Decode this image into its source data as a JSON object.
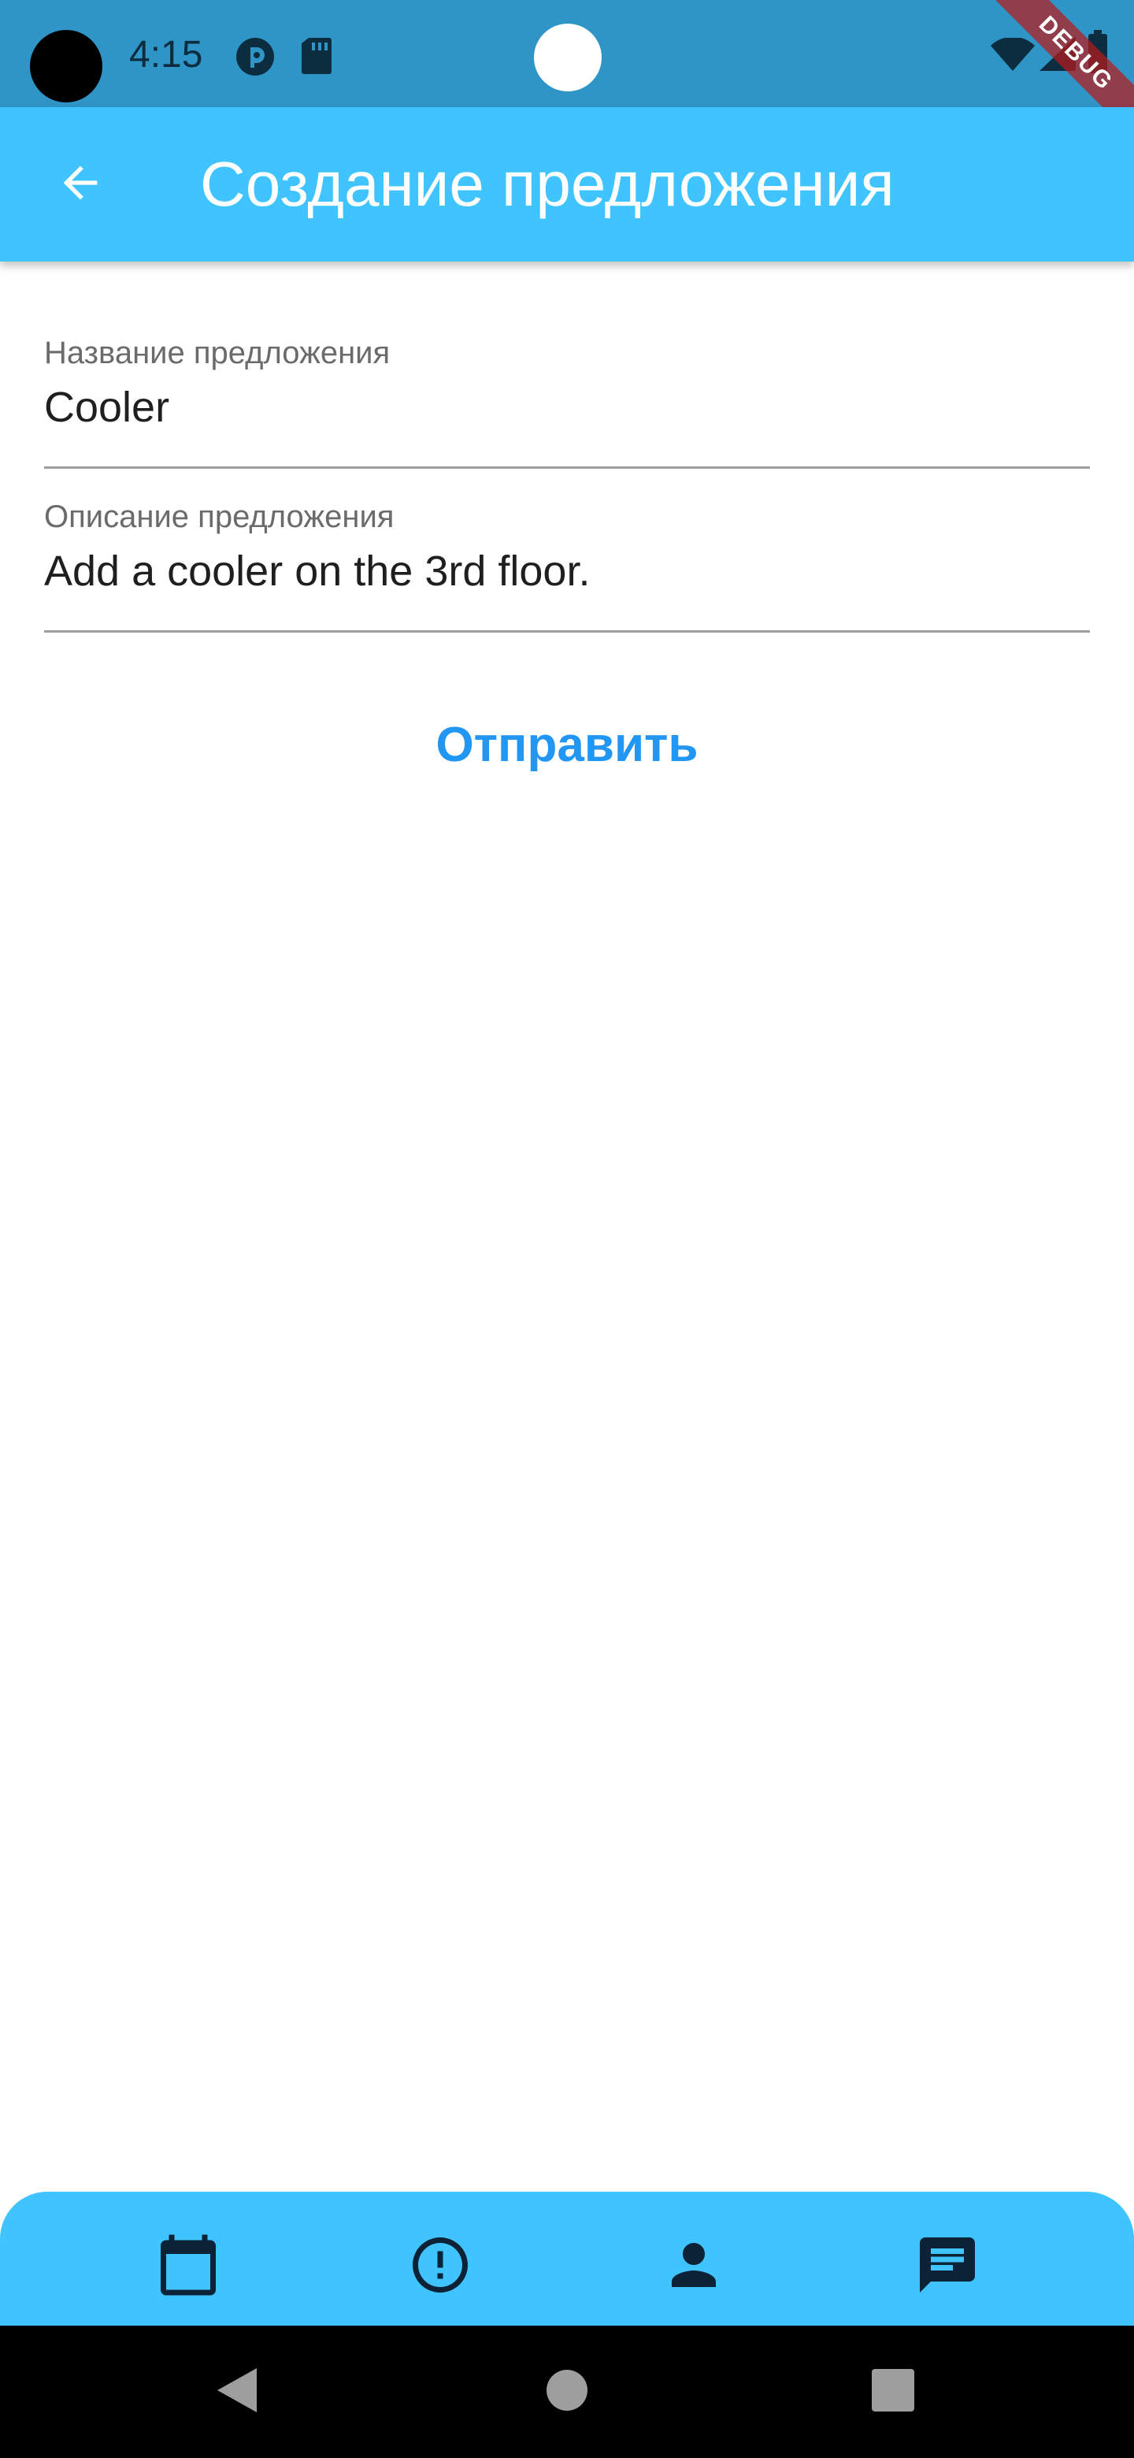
{
  "status_bar": {
    "time": "4:15",
    "icons": [
      "pocket-casts-icon",
      "sd-card-icon",
      "wifi-icon",
      "signal-icon",
      "battery-icon"
    ],
    "debug_label": "DEBUG"
  },
  "app_bar": {
    "title": "Создание предложения",
    "back_icon": "arrow-back-icon",
    "background_color": "#40c4ff"
  },
  "form": {
    "title_field": {
      "label": "Название предложения",
      "value": "Cooler"
    },
    "description_field": {
      "label": "Описание предложения",
      "value": "Add a cooler on the 3rd floor."
    },
    "submit_label": "Отправить",
    "accent_color": "#2196f3"
  },
  "bottom_nav": {
    "items": [
      {
        "icon": "calendar-icon"
      },
      {
        "icon": "alert-circle-icon"
      },
      {
        "icon": "person-icon"
      },
      {
        "icon": "chat-icon",
        "selected": true
      }
    ]
  },
  "system_nav": {
    "buttons": [
      "back-triangle-icon",
      "home-circle-icon",
      "recents-square-icon"
    ]
  }
}
